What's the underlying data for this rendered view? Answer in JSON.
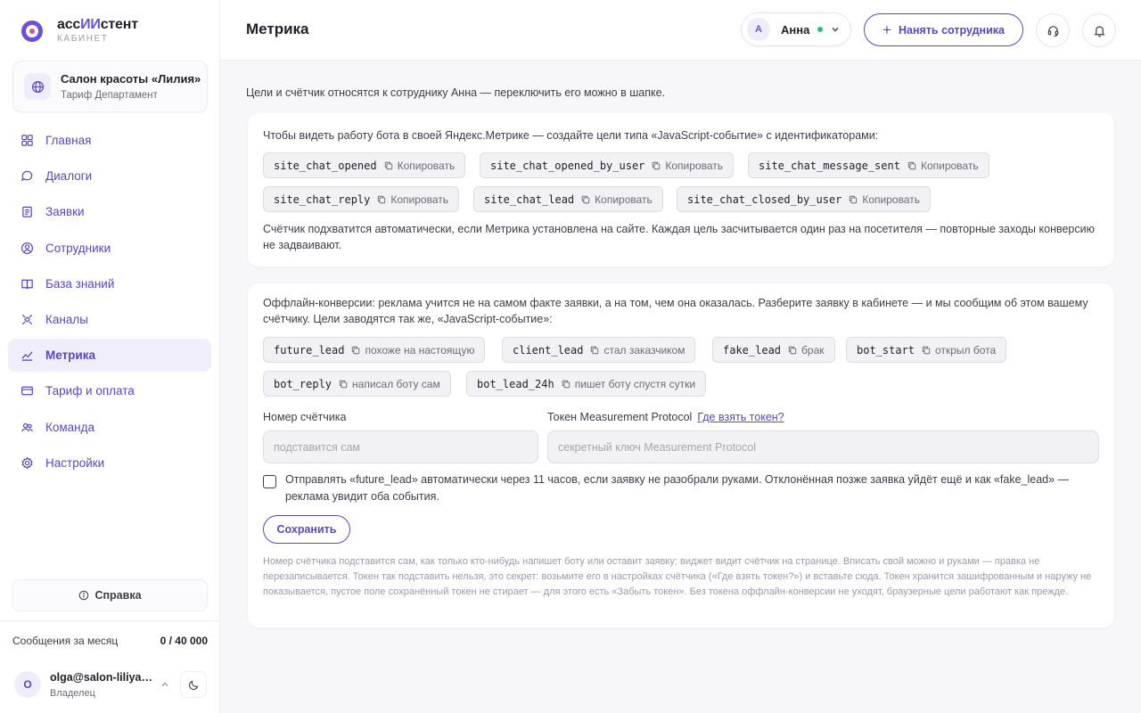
{
  "brand": {
    "name_prefix": "асс",
    "name_accent": "ИИ",
    "name_suffix": "стент",
    "subtitle": "КАБИНЕТ"
  },
  "organization": {
    "name": "Салон красоты «Лилия»",
    "plan": "Тариф Департамент"
  },
  "sidebar": {
    "items": [
      {
        "label": "Главная",
        "icon": "grid-icon"
      },
      {
        "label": "Диалоги",
        "icon": "chat-icon"
      },
      {
        "label": "Заявки",
        "icon": "clipboard-icon"
      },
      {
        "label": "Сотрудники",
        "icon": "person-circle-icon"
      },
      {
        "label": "База знаний",
        "icon": "book-icon"
      },
      {
        "label": "Каналы",
        "icon": "satellite-icon"
      },
      {
        "label": "Метрика",
        "icon": "chart-line-icon",
        "active": true
      },
      {
        "label": "Тариф и оплата",
        "icon": "card-icon"
      },
      {
        "label": "Команда",
        "icon": "team-icon"
      },
      {
        "label": "Настройки",
        "icon": "gear-icon"
      }
    ],
    "help_label": "Справка"
  },
  "usage": {
    "label": "Сообщения за месяц",
    "value": "0 / 40 000"
  },
  "user": {
    "avatar_letter": "O",
    "email": "olga@salon-liliya.ru",
    "role": "Владелец"
  },
  "header": {
    "title": "Метрика",
    "employee": {
      "avatar_letter": "А",
      "name": "Анна",
      "status_color": "#2fbf71"
    },
    "hire_label": "Нанять сотрудника"
  },
  "intro": "Цели и счётчик относятся к сотруднику Анна — переключить его можно в шапке.",
  "goals_card": {
    "text": "Чтобы видеть работу бота в своей Яндекс.Метрике — создайте цели типа «JavaScript-событие» с идентификаторами:",
    "chips": [
      {
        "code": "site_chat_opened",
        "action": "Копировать"
      },
      {
        "code": "site_chat_opened_by_user",
        "action": "Копировать"
      },
      {
        "code": "site_chat_message_sent",
        "action": "Копировать"
      },
      {
        "code": "site_chat_reply",
        "action": "Копировать"
      },
      {
        "code": "site_chat_lead",
        "action": "Копировать"
      },
      {
        "code": "site_chat_closed_by_user",
        "action": "Копировать"
      }
    ],
    "note": "Счётчик подхватится автоматически, если Метрика установлена на сайте. Каждая цель засчитывается один раз на посетителя — повторные заходы конверсию не задваивают."
  },
  "offline_card": {
    "text": "Оффлайн-конверсии: реклама учится не на самом факте заявки, а на том, чем она оказалась. Разберите заявку в кабинете — и мы сообщим об этом вашему счётчику. Цели заводятся так же, «JavaScript-событие»:",
    "chips": [
      {
        "code": "future_lead",
        "action": "похоже на настоящую"
      },
      {
        "code": "client_lead",
        "action": "стал заказчиком"
      },
      {
        "code": "fake_lead",
        "action": "брак"
      },
      {
        "code": "bot_start",
        "action": "открыл бота"
      },
      {
        "code": "bot_reply",
        "action": "написал боту сам"
      },
      {
        "code": "bot_lead_24h",
        "action": "пишет боту спустя сутки"
      }
    ],
    "counter_label": "Номер счётчика",
    "counter_placeholder": "подставится сам",
    "token_label": "Токен Measurement Protocol",
    "token_link": "Где взять токен?",
    "token_placeholder": "секретный ключ Measurement Protocol",
    "checkbox_label": "Отправлять «future_lead» автоматически через 11 часов, если заявку не разобрали руками. Отклонённая позже заявка уйдёт ещё и как «fake_lead» — реклама увидит оба события.",
    "checkbox_checked": false,
    "save_label": "Сохранить",
    "footnote": "Номер счётчика подставится сам, как только кто-нибудь напишет боту или оставит заявку: виджет видит счётчик на странице. Вписать свой можно и руками — правка не перезаписывается. Токен так подставить нельзя, это секрет: возьмите его в настройках счётчика («Где взять токен?») и вставьте сюда. Токен хранится зашифрованным и наружу не показывается, пустое поле сохранённый токен не стирает — для этого есть «Забыть токен». Без токена оффлайн-конверсии не уходят, браузерные цели работают как прежде."
  },
  "colors": {
    "accent": "#5a46c8",
    "brand": "#6d4fd8",
    "active_bg": "#f0eefb",
    "page_bg": "#f7f7f9"
  }
}
